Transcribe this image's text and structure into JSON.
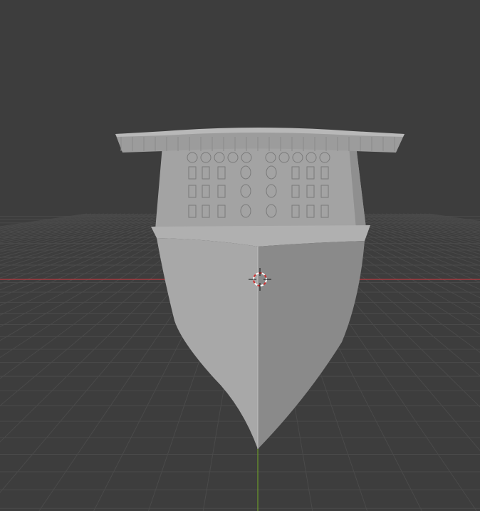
{
  "viewport": {
    "background_color": "#3d3d3d",
    "grid_color": "#4a4a4a",
    "x_axis_color": "#b8393f",
    "y_axis_color": "#6b9a2a"
  },
  "model": {
    "hull_left_color": "#a6a6a6",
    "hull_right_color": "#8a8a8a",
    "superstructure_color": "#a3a3a3",
    "deck_color": "#9c9c9c",
    "window_stroke_color": "#7a7a7a"
  },
  "icons": {
    "cursor": "3d-cursor-icon"
  }
}
